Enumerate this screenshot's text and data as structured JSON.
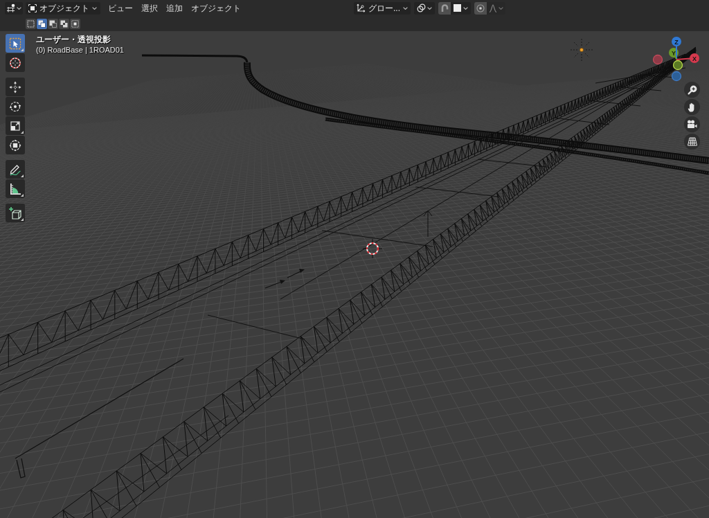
{
  "header": {
    "mode": {
      "label": "オブジェクト"
    },
    "menus": [
      "ビュー",
      "選択",
      "追加",
      "オブジェクト"
    ],
    "orientation": {
      "label": "グロー..."
    },
    "snapping": {
      "on": false
    },
    "proportional_editing": {
      "on": false
    },
    "falloff": {
      "disabled": true
    }
  },
  "tool_settings": {
    "select_modes": [
      {
        "kind": "set",
        "selected": false
      },
      {
        "kind": "extend",
        "selected": true
      },
      {
        "kind": "subtract",
        "selected": false
      },
      {
        "kind": "difference",
        "selected": false
      },
      {
        "kind": "intersect",
        "selected": false
      }
    ]
  },
  "toolbar": {
    "groups": [
      {
        "tools": [
          {
            "kind": "select_box",
            "selected": true,
            "more": true
          },
          {
            "kind": "cursor",
            "selected": false,
            "more": false
          }
        ]
      },
      {
        "tools": [
          {
            "kind": "move",
            "selected": false,
            "more": false
          },
          {
            "kind": "rotate",
            "selected": false,
            "more": false
          },
          {
            "kind": "scale",
            "selected": false,
            "more": true
          },
          {
            "kind": "transform",
            "selected": false,
            "more": false
          }
        ]
      },
      {
        "tools": [
          {
            "kind": "annotate",
            "selected": false,
            "more": true
          },
          {
            "kind": "measure",
            "selected": false,
            "more": true
          }
        ]
      },
      {
        "tools": [
          {
            "kind": "add_cube",
            "selected": false,
            "more": true
          }
        ]
      }
    ]
  },
  "viewport": {
    "view_name": "ユーザー・透視投影",
    "object_info": "(0) RoadBase | 1ROAD01"
  },
  "gizmo": {
    "axes": [
      {
        "kind": "positive",
        "label": "Z",
        "color": "#2f79d5"
      },
      {
        "kind": "positive",
        "label": "Y",
        "color": "#6b9a28"
      },
      {
        "kind": "positive",
        "label": "X",
        "color": "#d5394d"
      },
      {
        "kind": "negative",
        "color": "#8f3a47"
      },
      {
        "kind": "negative",
        "color": "#5a7a24"
      },
      {
        "kind": "negative",
        "color": "#2c5f98"
      }
    ]
  }
}
